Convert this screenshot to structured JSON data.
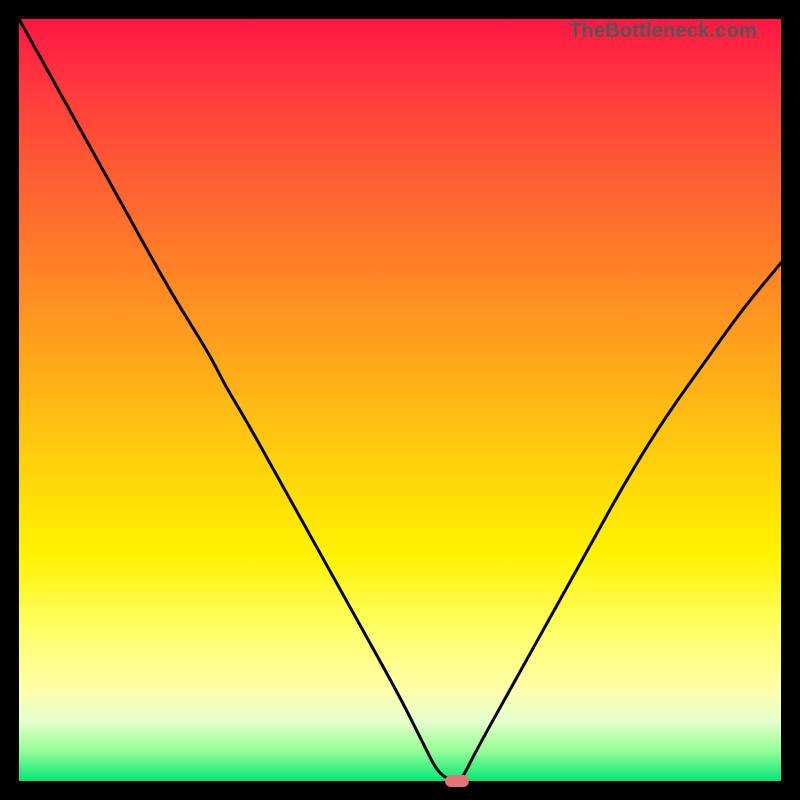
{
  "watermark": "TheBottleneck.com",
  "colors": {
    "frame": "#000000",
    "curve": "#000000",
    "marker": "#e57373"
  },
  "chart_data": {
    "type": "line",
    "title": "",
    "xlabel": "",
    "ylabel": "",
    "xlim": [
      0,
      100
    ],
    "ylim": [
      0,
      100
    ],
    "x": [
      0,
      5,
      10,
      15,
      20,
      25,
      27,
      30,
      35,
      40,
      45,
      50,
      53,
      55,
      57,
      58,
      60,
      65,
      70,
      75,
      80,
      85,
      90,
      95,
      100
    ],
    "values": [
      100,
      91,
      82,
      73,
      64,
      56,
      52,
      47,
      38,
      29,
      20,
      11,
      5,
      1,
      0,
      0,
      4,
      13,
      22,
      31,
      40,
      48,
      55,
      62,
      68
    ],
    "marker": {
      "x": 57.5,
      "y": 0
    },
    "grid": false,
    "legend": false
  }
}
